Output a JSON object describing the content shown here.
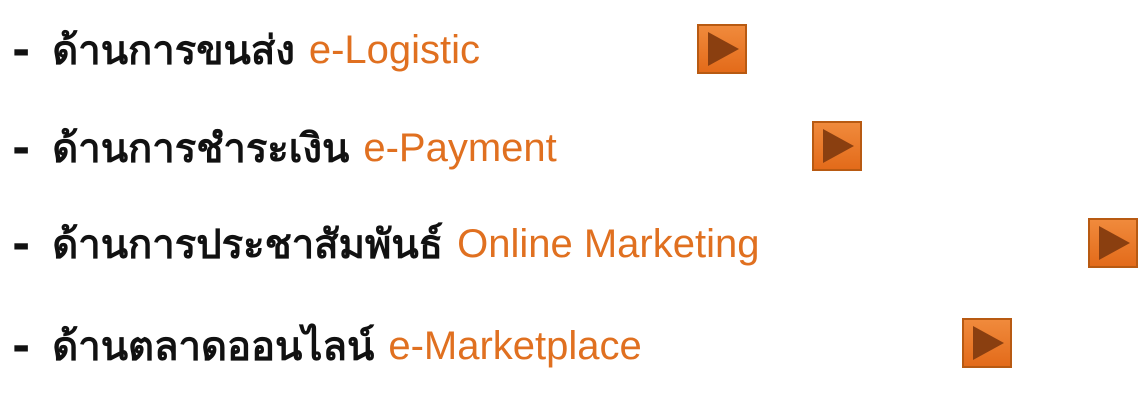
{
  "items": [
    {
      "dash": "-",
      "thai": "ด้านการขนส่ง",
      "eng": "e-Logistic",
      "button_icon": "play-triangle-icon"
    },
    {
      "dash": "-",
      "thai": "ด้านการชำระเงิน",
      "eng": "e-Payment",
      "button_icon": "play-triangle-icon"
    },
    {
      "dash": "-",
      "thai": "ด้านการประชาสัมพันธ์",
      "eng": "Online Marketing",
      "button_icon": "play-triangle-icon"
    },
    {
      "dash": "-",
      "thai": "ด้านตลาดออนไลน์",
      "eng": "e-Marketplace",
      "button_icon": "play-triangle-icon"
    }
  ],
  "colors": {
    "text": "#111111",
    "accent": "#e07020",
    "button_fill": "#e36b1a",
    "button_border": "#b85a12",
    "triangle": "#8a3f10"
  }
}
